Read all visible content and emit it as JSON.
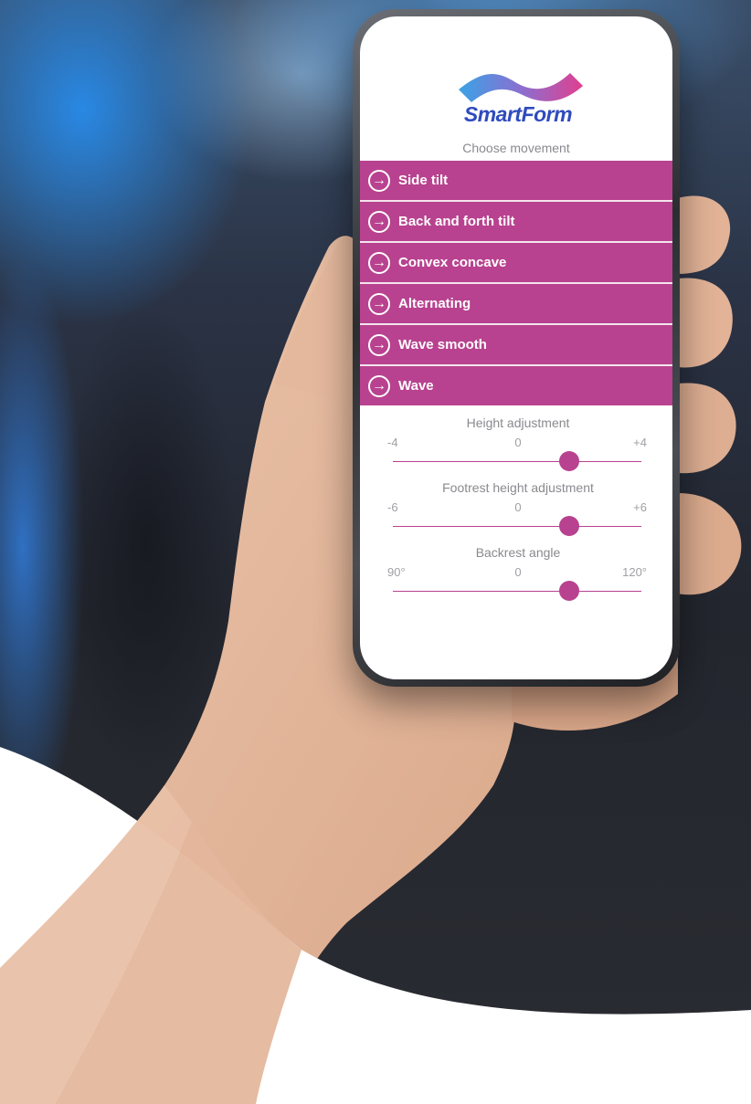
{
  "app": {
    "brand": "SmartForm",
    "subtitle": "Choose movement"
  },
  "menu": {
    "items": [
      {
        "label": "Side tilt"
      },
      {
        "label": "Back and forth tilt"
      },
      {
        "label": "Convex concave"
      },
      {
        "label": "Alternating"
      },
      {
        "label": "Wave smooth"
      },
      {
        "label": "Wave"
      }
    ]
  },
  "sliders": [
    {
      "title": "Height adjustment",
      "min": "-4",
      "mid": "0",
      "max": "+4",
      "value_fraction": 0.71
    },
    {
      "title": "Footrest height adjustment",
      "min": "-6",
      "mid": "0",
      "max": "+6",
      "value_fraction": 0.71
    },
    {
      "title": "Backrest angle",
      "min": "90°",
      "mid": "0",
      "max": "120°",
      "value_fraction": 0.71
    }
  ],
  "colors": {
    "accent": "#b8428f",
    "brand_text": "#2f4bbd",
    "logo_gradient_start": "#3aa3e6",
    "logo_gradient_end": "#e0408f"
  },
  "icons": {
    "menu_arrow": "arrow-right-circle-icon"
  }
}
